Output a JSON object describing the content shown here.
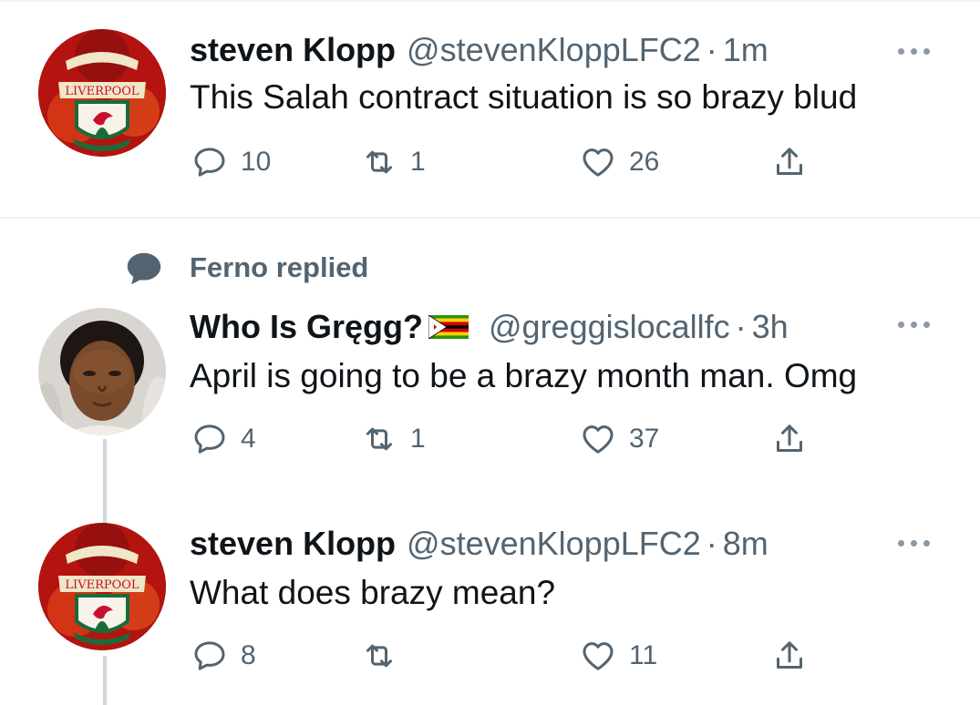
{
  "replied_banner": {
    "text": "Ferno replied",
    "icon": "speech-bubble-icon"
  },
  "tweets": [
    {
      "display_name": "steven Klopp",
      "handle": "@stevenKloppLFC2",
      "separator": "·",
      "time": "1m",
      "text": "This Salah contract situation is so brazy blud",
      "replies": "10",
      "retweets": "1",
      "likes": "26",
      "avatar": "liverpool-crest-avatar"
    },
    {
      "display_name": "Who Is Gręgg?",
      "flag": "zimbabwe-flag",
      "handle": "@greggislocallfc",
      "separator": "·",
      "time": "3h",
      "text": "April is going to be a brazy month man. Omg",
      "replies": "4",
      "retweets": "1",
      "likes": "37",
      "avatar": "person-photo-avatar"
    },
    {
      "display_name": "steven Klopp",
      "handle": "@stevenKloppLFC2",
      "separator": "·",
      "time": "8m",
      "text": "What does brazy mean?",
      "replies": "8",
      "retweets": "",
      "likes": "11",
      "avatar": "liverpool-crest-avatar"
    }
  ],
  "colors": {
    "text_primary": "#0f1419",
    "text_secondary": "#536471",
    "thread_line": "#cfd9de",
    "divider": "#eff3f4",
    "crest_red": "#c8102e"
  }
}
